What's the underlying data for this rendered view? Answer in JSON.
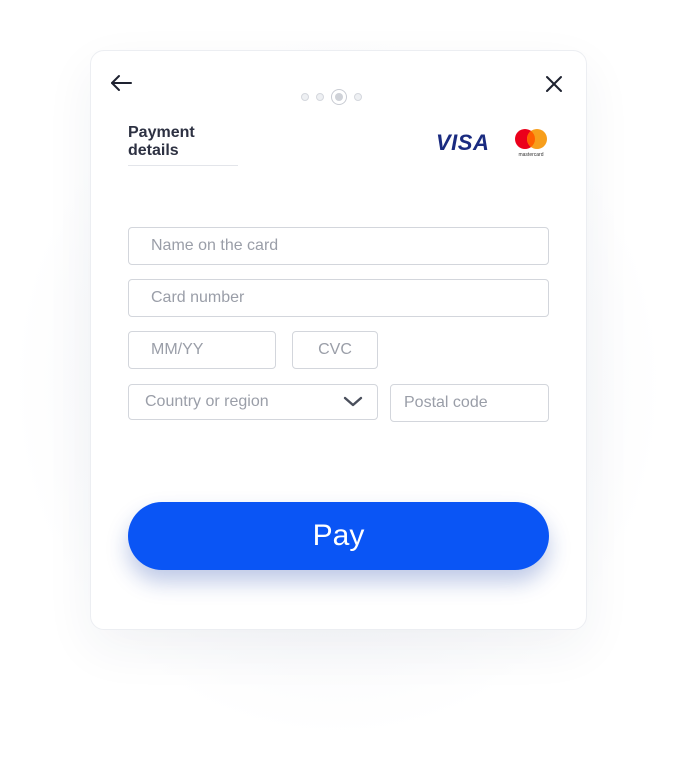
{
  "header": {
    "title": "Payment details",
    "steps": {
      "total": 4,
      "current": 3
    }
  },
  "brands": {
    "visa_label": "VISA",
    "mastercard_label": "mastercard"
  },
  "form": {
    "name_placeholder": "Name on the card",
    "number_placeholder": "Card number",
    "expiry_placeholder": "MM/YY",
    "cvc_placeholder": "CVC",
    "country_placeholder": "Country or region",
    "postal_placeholder": "Postal code"
  },
  "actions": {
    "pay_label": "Pay"
  },
  "icons": {
    "back": "arrow-left-icon",
    "close": "close-icon",
    "dropdown": "chevron-down-icon"
  },
  "colors": {
    "accent": "#0a55f5",
    "visa": "#1a2b80",
    "mastercard_red": "#eb001b",
    "mastercard_orange": "#f79e1b"
  }
}
